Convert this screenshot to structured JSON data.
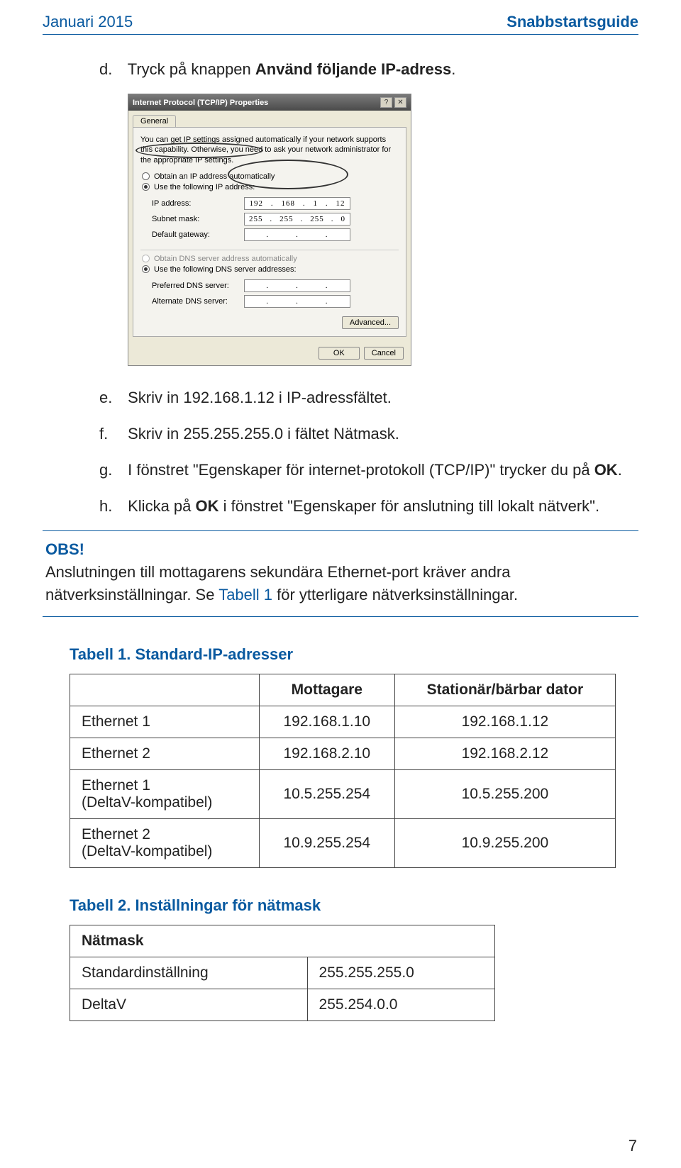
{
  "header": {
    "left": "Januari 2015",
    "right": "Snabbstartsguide"
  },
  "steps": {
    "d": {
      "marker": "d.",
      "pre": "Tryck på knappen ",
      "bold": "Använd följande IP-adress",
      "post": "."
    },
    "e": {
      "marker": "e.",
      "text": "Skriv in 192.168.1.12 i IP-adressfältet."
    },
    "f": {
      "marker": "f.",
      "text": "Skriv in 255.255.255.0 i fältet Nätmask."
    },
    "g": {
      "marker": "g.",
      "pre": "I fönstret \"Egenskaper för internet-protokoll (TCP/IP)\" trycker du på ",
      "bold": "OK",
      "post": "."
    },
    "h": {
      "marker": "h.",
      "pre": "Klicka på ",
      "bold": "OK",
      "post": " i fönstret \"Egenskaper för anslutning till lokalt nätverk\"."
    }
  },
  "dialog": {
    "title": "Internet Protocol (TCP/IP) Properties",
    "tab": "General",
    "desc": "You can get IP settings assigned automatically if your network supports this capability. Otherwise, you need to ask your network administrator for the appropriate IP settings.",
    "radio_auto_ip": "Obtain an IP address automatically",
    "radio_use_ip": "Use the following IP address:",
    "lbl_ip": "IP address:",
    "lbl_subnet": "Subnet mask:",
    "lbl_gateway": "Default gateway:",
    "ip_val": [
      "192",
      "168",
      "1",
      "12"
    ],
    "subnet_val": [
      "255",
      "255",
      "255",
      "0"
    ],
    "radio_auto_dns": "Obtain DNS server address automatically",
    "radio_use_dns": "Use the following DNS server addresses:",
    "lbl_pref_dns": "Preferred DNS server:",
    "lbl_alt_dns": "Alternate DNS server:",
    "btn_adv": "Advanced...",
    "btn_ok": "OK",
    "btn_cancel": "Cancel"
  },
  "obs": {
    "title": "OBS!",
    "line1": "Anslutningen till mottagarens sekundära Ethernet-port kräver andra nätverksinställningar. Se ",
    "link": "Tabell 1",
    "line2": " för ytterligare nätverksinställningar."
  },
  "table1": {
    "title": "Tabell 1. Standard-IP-adresser",
    "head": [
      "",
      "Mottagare",
      "Stationär/bärbar dator"
    ],
    "rows": [
      [
        "Ethernet 1",
        "192.168.1.10",
        "192.168.1.12"
      ],
      [
        "Ethernet 2",
        "192.168.2.10",
        "192.168.2.12"
      ],
      [
        "Ethernet 1\n(DeltaV-kompatibel)",
        "10.5.255.254",
        "10.5.255.200"
      ],
      [
        "Ethernet 2\n(DeltaV-kompatibel)",
        "10.9.255.254",
        "10.9.255.200"
      ]
    ]
  },
  "table2": {
    "title": "Tabell 2. Inställningar för nätmask",
    "head": "Nätmask",
    "rows": [
      [
        "Standardinställning",
        "255.255.255.0"
      ],
      [
        "DeltaV",
        "255.254.0.0"
      ]
    ]
  },
  "pagenum": "7"
}
